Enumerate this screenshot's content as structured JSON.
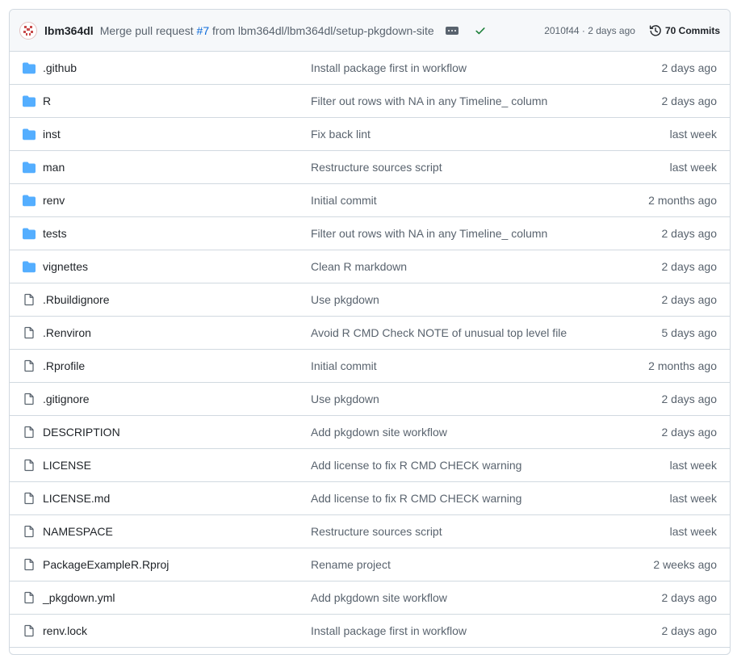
{
  "commit": {
    "author": "lbm364dl",
    "message_prefix": "Merge pull request ",
    "pr_ref": "#7",
    "message_suffix": " from lbm364dl/lbm364dl/setup-pkgdown-site",
    "sha_time": "2010f44 · 2 days ago",
    "commits_label": "70 Commits",
    "status": "success"
  },
  "colors": {
    "folder": "#54aeff",
    "link": "#0969da",
    "success": "#1a7f37",
    "muted": "#59636e"
  },
  "files": [
    {
      "type": "dir",
      "icon": "folder-icon",
      "name": ".github",
      "message": "Install package first in workflow",
      "age": "2 days ago"
    },
    {
      "type": "dir",
      "icon": "folder-icon",
      "name": "R",
      "message": "Filter out rows with NA in any Timeline_ column",
      "age": "2 days ago"
    },
    {
      "type": "dir",
      "icon": "folder-icon",
      "name": "inst",
      "message": "Fix back lint",
      "age": "last week"
    },
    {
      "type": "dir",
      "icon": "folder-icon",
      "name": "man",
      "message": "Restructure sources script",
      "age": "last week"
    },
    {
      "type": "dir",
      "icon": "folder-icon",
      "name": "renv",
      "message": "Initial commit",
      "age": "2 months ago"
    },
    {
      "type": "dir",
      "icon": "folder-icon",
      "name": "tests",
      "message": "Filter out rows with NA in any Timeline_ column",
      "age": "2 days ago"
    },
    {
      "type": "dir",
      "icon": "folder-icon",
      "name": "vignettes",
      "message": "Clean R markdown",
      "age": "2 days ago"
    },
    {
      "type": "file",
      "icon": "file-icon",
      "name": ".Rbuildignore",
      "message": "Use pkgdown",
      "age": "2 days ago"
    },
    {
      "type": "file",
      "icon": "file-icon",
      "name": ".Renviron",
      "message": "Avoid R CMD Check NOTE of unusual top level file",
      "age": "5 days ago"
    },
    {
      "type": "file",
      "icon": "file-icon",
      "name": ".Rprofile",
      "message": "Initial commit",
      "age": "2 months ago"
    },
    {
      "type": "file",
      "icon": "file-icon",
      "name": ".gitignore",
      "message": "Use pkgdown",
      "age": "2 days ago"
    },
    {
      "type": "file",
      "icon": "file-icon",
      "name": "DESCRIPTION",
      "message": "Add pkgdown site workflow",
      "age": "2 days ago"
    },
    {
      "type": "file",
      "icon": "file-icon",
      "name": "LICENSE",
      "message": "Add license to fix R CMD CHECK warning",
      "age": "last week"
    },
    {
      "type": "file",
      "icon": "file-icon",
      "name": "LICENSE.md",
      "message": "Add license to fix R CMD CHECK warning",
      "age": "last week"
    },
    {
      "type": "file",
      "icon": "file-icon",
      "name": "NAMESPACE",
      "message": "Restructure sources script",
      "age": "last week"
    },
    {
      "type": "file",
      "icon": "file-icon",
      "name": "PackageExampleR.Rproj",
      "message": "Rename project",
      "age": "2 weeks ago"
    },
    {
      "type": "file",
      "icon": "file-icon",
      "name": "_pkgdown.yml",
      "message": "Add pkgdown site workflow",
      "age": "2 days ago"
    },
    {
      "type": "file",
      "icon": "file-icon",
      "name": "renv.lock",
      "message": "Install package first in workflow",
      "age": "2 days ago"
    }
  ]
}
